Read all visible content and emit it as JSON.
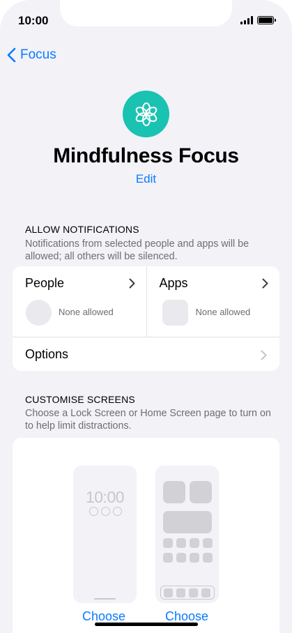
{
  "status_bar": {
    "time": "10:00"
  },
  "nav": {
    "back_label": "Focus"
  },
  "focus": {
    "icon": "flower-icon",
    "title": "Mindfulness Focus",
    "edit_label": "Edit",
    "accent_color": "#1ac2b1"
  },
  "allow_notifications": {
    "header": "ALLOW NOTIFICATIONS",
    "description": "Notifications from selected people and apps will be allowed; all others will be silenced.",
    "people": {
      "label": "People",
      "status": "None allowed"
    },
    "apps": {
      "label": "Apps",
      "status": "None allowed"
    },
    "options_label": "Options"
  },
  "customise_screens": {
    "header": "CUSTOMISE SCREENS",
    "description": "Choose a Lock Screen or Home Screen page to turn on to help limit distractions.",
    "lock_screen_time": "10:00",
    "lock_choose_label": "Choose",
    "home_choose_label": "Choose"
  },
  "colors": {
    "link": "#0a7aff",
    "background": "#f2f2f7"
  }
}
